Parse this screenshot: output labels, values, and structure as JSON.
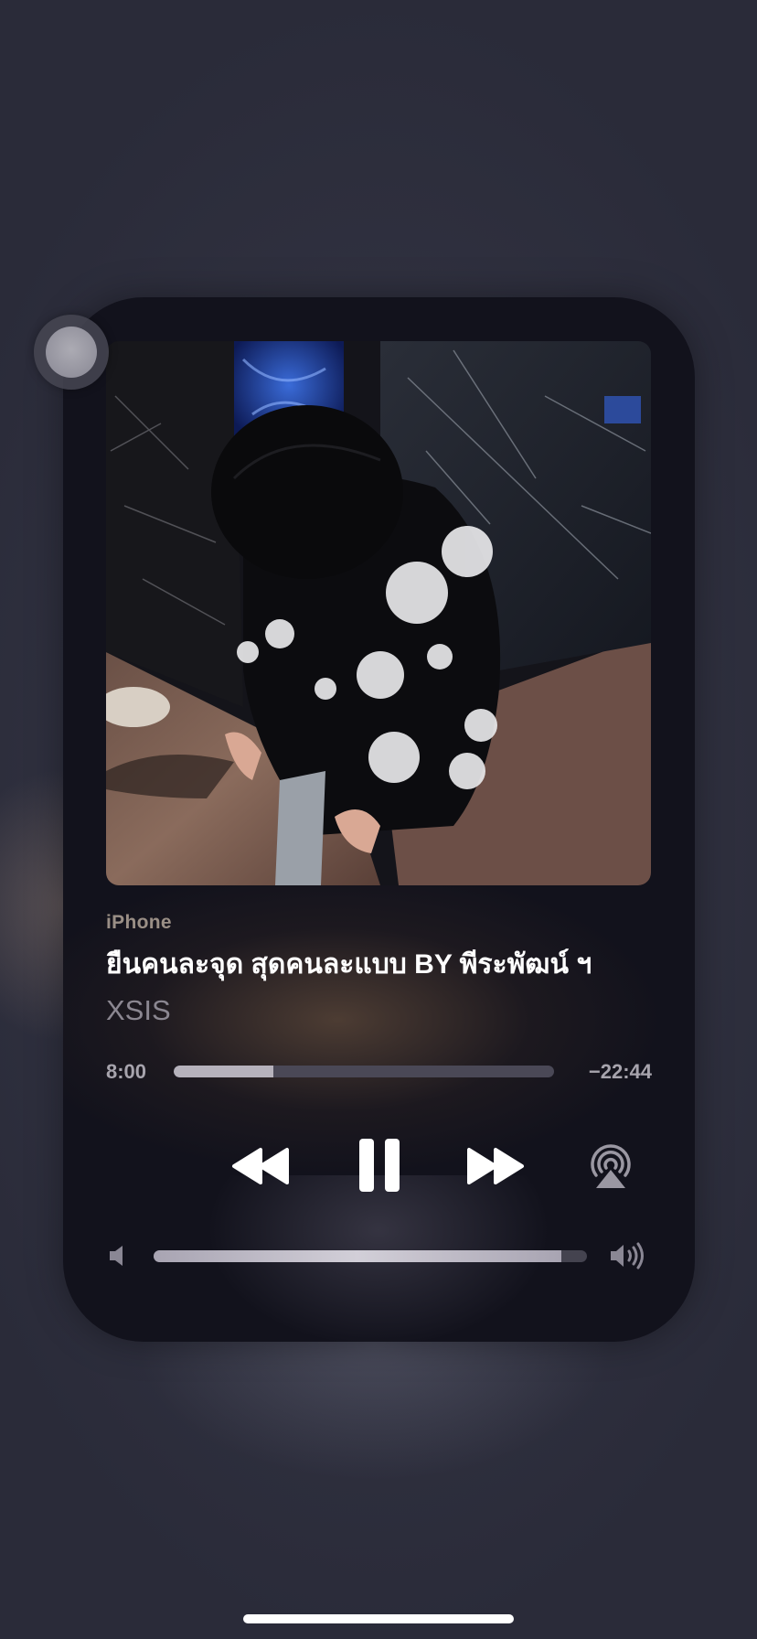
{
  "now_playing": {
    "source": "iPhone",
    "title": "ยืนคนละจุด สุดคนละแบบ BY พีระพัฒน์ ฯ",
    "artist": "XSIS",
    "artwork_icon": "album-artwork-photo"
  },
  "playback": {
    "elapsed": "8:00",
    "remaining": "−22:44",
    "progress_fraction": 0.263,
    "state": "playing"
  },
  "controls": {
    "rewind_icon": "rewind-icon",
    "pause_icon": "pause-icon",
    "forward_icon": "fast-forward-icon",
    "airplay_icon": "airplay-audio-icon"
  },
  "volume": {
    "level_fraction": 0.94,
    "min_icon": "speaker-low-icon",
    "max_icon": "speaker-high-icon"
  },
  "colors": {
    "card_background": "#12121c",
    "page_background": "#32333f",
    "title_text": "#ffffff",
    "secondary_text": "#8b8791",
    "progress_fill": "#b6b2bc",
    "progress_track": "#4a4856"
  }
}
